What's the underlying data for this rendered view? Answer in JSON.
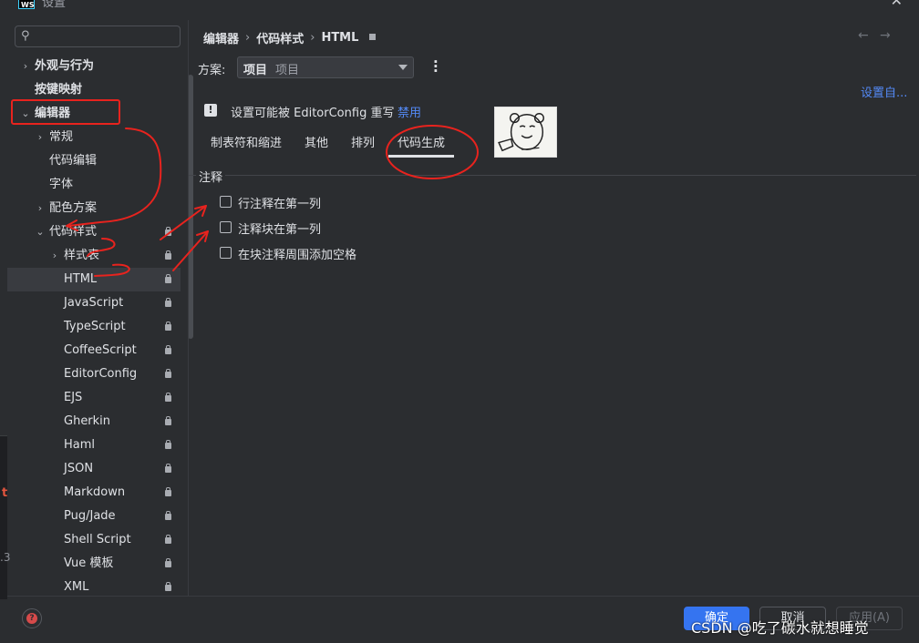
{
  "window": {
    "title": "设置",
    "app_logo": "WS"
  },
  "search": {
    "placeholder": "",
    "value": ""
  },
  "tree": [
    {
      "label": "外观与行为",
      "level": 0,
      "arrow": "›",
      "bold": true,
      "lock": false,
      "selected": false
    },
    {
      "label": "按键映射",
      "level": 0,
      "arrow": "",
      "bold": true,
      "lock": false,
      "selected": false
    },
    {
      "label": "编辑器",
      "level": 0,
      "arrow": "⌄",
      "bold": true,
      "lock": false,
      "selected": false
    },
    {
      "label": "常规",
      "level": 1,
      "arrow": "›",
      "bold": false,
      "lock": false,
      "selected": false
    },
    {
      "label": "代码编辑",
      "level": 1,
      "arrow": "",
      "bold": false,
      "lock": false,
      "selected": false
    },
    {
      "label": "字体",
      "level": 1,
      "arrow": "",
      "bold": false,
      "lock": false,
      "selected": false
    },
    {
      "label": "配色方案",
      "level": 1,
      "arrow": "›",
      "bold": false,
      "lock": false,
      "selected": false
    },
    {
      "label": "代码样式",
      "level": 1,
      "arrow": "⌄",
      "bold": false,
      "lock": true,
      "selected": false
    },
    {
      "label": "样式表",
      "level": 2,
      "arrow": "›",
      "bold": false,
      "lock": true,
      "selected": false
    },
    {
      "label": "HTML",
      "level": 2,
      "arrow": "",
      "bold": false,
      "lock": true,
      "selected": true
    },
    {
      "label": "JavaScript",
      "level": 2,
      "arrow": "",
      "bold": false,
      "lock": true,
      "selected": false
    },
    {
      "label": "TypeScript",
      "level": 2,
      "arrow": "",
      "bold": false,
      "lock": true,
      "selected": false
    },
    {
      "label": "CoffeeScript",
      "level": 2,
      "arrow": "",
      "bold": false,
      "lock": true,
      "selected": false
    },
    {
      "label": "EditorConfig",
      "level": 2,
      "arrow": "",
      "bold": false,
      "lock": true,
      "selected": false
    },
    {
      "label": "EJS",
      "level": 2,
      "arrow": "",
      "bold": false,
      "lock": true,
      "selected": false
    },
    {
      "label": "Gherkin",
      "level": 2,
      "arrow": "",
      "bold": false,
      "lock": true,
      "selected": false
    },
    {
      "label": "Haml",
      "level": 2,
      "arrow": "",
      "bold": false,
      "lock": true,
      "selected": false
    },
    {
      "label": "JSON",
      "level": 2,
      "arrow": "",
      "bold": false,
      "lock": true,
      "selected": false
    },
    {
      "label": "Markdown",
      "level": 2,
      "arrow": "",
      "bold": false,
      "lock": true,
      "selected": false
    },
    {
      "label": "Pug/Jade",
      "level": 2,
      "arrow": "",
      "bold": false,
      "lock": true,
      "selected": false
    },
    {
      "label": "Shell Script",
      "level": 2,
      "arrow": "",
      "bold": false,
      "lock": true,
      "selected": false
    },
    {
      "label": "Vue 模板",
      "level": 2,
      "arrow": "",
      "bold": false,
      "lock": true,
      "selected": false
    },
    {
      "label": "XML",
      "level": 2,
      "arrow": "",
      "bold": false,
      "lock": true,
      "selected": false
    }
  ],
  "breadcrumb": {
    "items": [
      "编辑器",
      "代码样式",
      "HTML"
    ],
    "separator": "›"
  },
  "nav": {
    "back": "←",
    "forward": "→"
  },
  "scheme": {
    "label": "方案:",
    "value": "项目",
    "sub": "项目"
  },
  "settings_link": "设置自...",
  "editorconfig": {
    "warning_glyph": "!",
    "note": "设置可能被 EditorConfig 重写",
    "disable_link": "禁用"
  },
  "tabs": [
    {
      "label": "制表符和缩进",
      "active": false
    },
    {
      "label": "其他",
      "active": false
    },
    {
      "label": "排列",
      "active": false
    },
    {
      "label": "代码生成",
      "active": true
    }
  ],
  "section": {
    "title": "注释"
  },
  "options": [
    {
      "label": "行注释在第一列",
      "checked": false
    },
    {
      "label": "注释块在第一列",
      "checked": false
    },
    {
      "label": "在块注释周围添加空格",
      "checked": false
    }
  ],
  "buttons": {
    "ok": "确定",
    "cancel": "取消",
    "apply": "应用(A)"
  },
  "watermark": "CSDN @吃了碳水就想睡觉",
  "colors": {
    "background": "#2b2d30",
    "accent": "#3574f0",
    "link": "#548af7",
    "annotation": "#e8231e"
  },
  "icons": {
    "search": "search-icon",
    "close": "close-icon",
    "lock": "lock-icon",
    "help": "help-icon",
    "kebab": "kebab-menu-icon"
  }
}
